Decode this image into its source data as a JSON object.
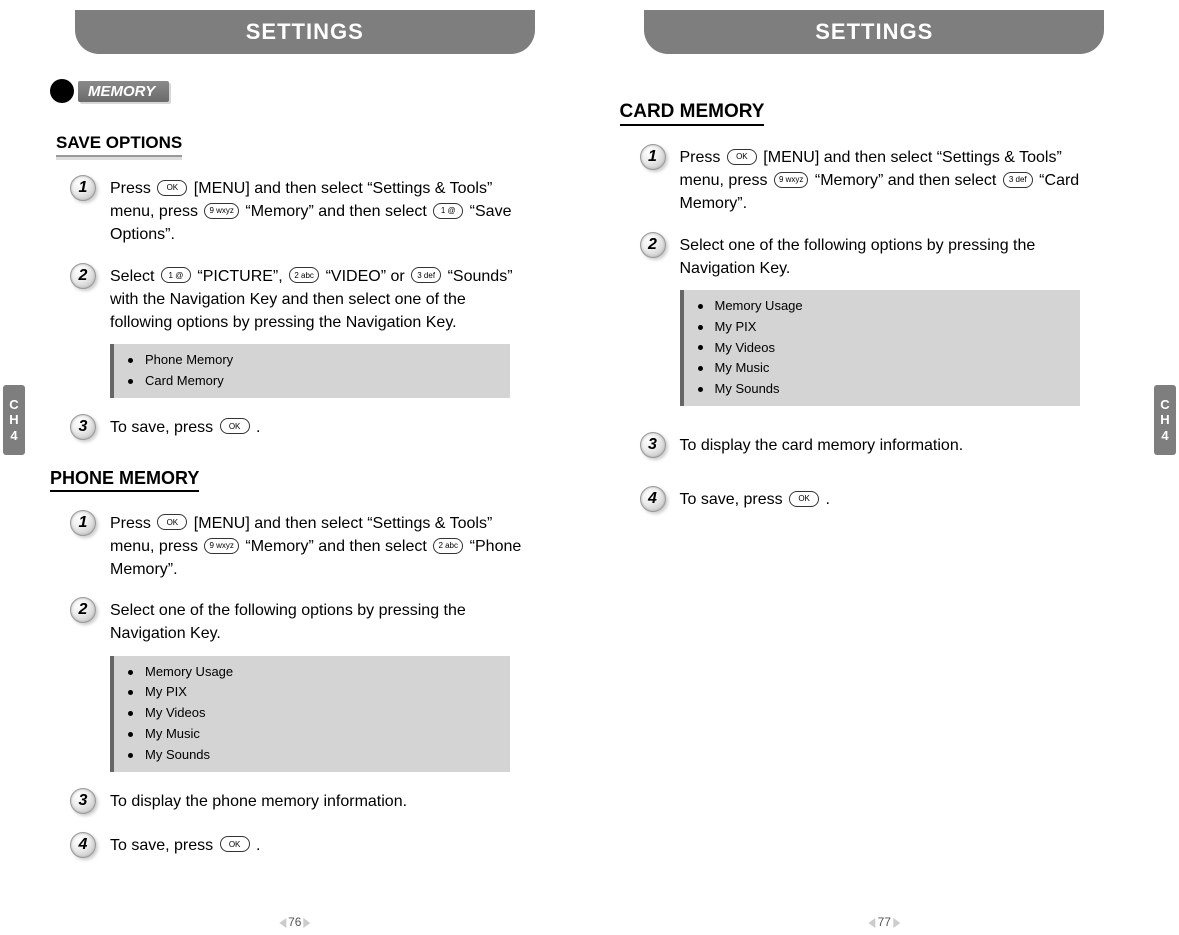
{
  "left": {
    "title": "SETTINGS",
    "chapter": "CH4",
    "badge": "MEMORY",
    "section1": {
      "heading": "SAVE OPTIONS",
      "steps": {
        "s1": {
          "num": "1",
          "pre": "Press ",
          "key1": "OK",
          "mid1": " [MENU] and then select “Settings & Tools” menu, press ",
          "key2": "9 wxyz",
          "mid2": " “Memory” and then select ",
          "key3": "1 @",
          "post": " “Save Options”."
        },
        "s2": {
          "num": "2",
          "pre": "Select ",
          "key1": "1 @",
          "mid1": " “PICTURE”, ",
          "key2": "2 abc",
          "mid2": " “VIDEO” or ",
          "key3": "3 def",
          "post": " “Sounds” with the Navigation Key and then select one of the following options by pressing the Navigation Key."
        },
        "s3": {
          "num": "3",
          "pre": "To save, press ",
          "key1": "OK",
          "post": " ."
        }
      },
      "options": [
        "Phone Memory",
        "Card Memory"
      ]
    },
    "section2": {
      "heading": "PHONE MEMORY",
      "steps": {
        "s1": {
          "num": "1",
          "pre": "Press ",
          "key1": "OK",
          "mid1": " [MENU] and then select “Settings & Tools” menu, press ",
          "key2": "9 wxyz",
          "mid2": " “Memory” and then select ",
          "key3": "2 abc",
          "post": " “Phone Memory”."
        },
        "s2": {
          "num": "2",
          "text": "Select one of the following options by pressing the Navigation Key."
        },
        "s3": {
          "num": "3",
          "text": "To display the phone memory information."
        },
        "s4": {
          "num": "4",
          "pre": "To save, press ",
          "key1": "OK",
          "post": " ."
        }
      },
      "options": [
        "Memory Usage",
        "My PIX",
        "My Videos",
        "My Music",
        "My Sounds"
      ]
    },
    "pagenum": "76"
  },
  "right": {
    "title": "SETTINGS",
    "chapter": "CH4",
    "section": {
      "heading": "CARD MEMORY",
      "steps": {
        "s1": {
          "num": "1",
          "pre": "Press ",
          "key1": "OK",
          "mid1": " [MENU] and then select “Settings & Tools” menu, press ",
          "key2": "9 wxyz",
          "mid2": " “Memory” and then select ",
          "key3": "3 def",
          "post": " “Card Memory”."
        },
        "s2": {
          "num": "2",
          "text": "Select one of the following options by pressing the Navigation Key."
        },
        "s3": {
          "num": "3",
          "text": "To display the card memory information."
        },
        "s4": {
          "num": "4",
          "pre": "To save, press ",
          "key1": "OK",
          "post": " ."
        }
      },
      "options": [
        "Memory Usage",
        "My PIX",
        "My Videos",
        "My Music",
        "My Sounds"
      ]
    },
    "pagenum": "77"
  }
}
